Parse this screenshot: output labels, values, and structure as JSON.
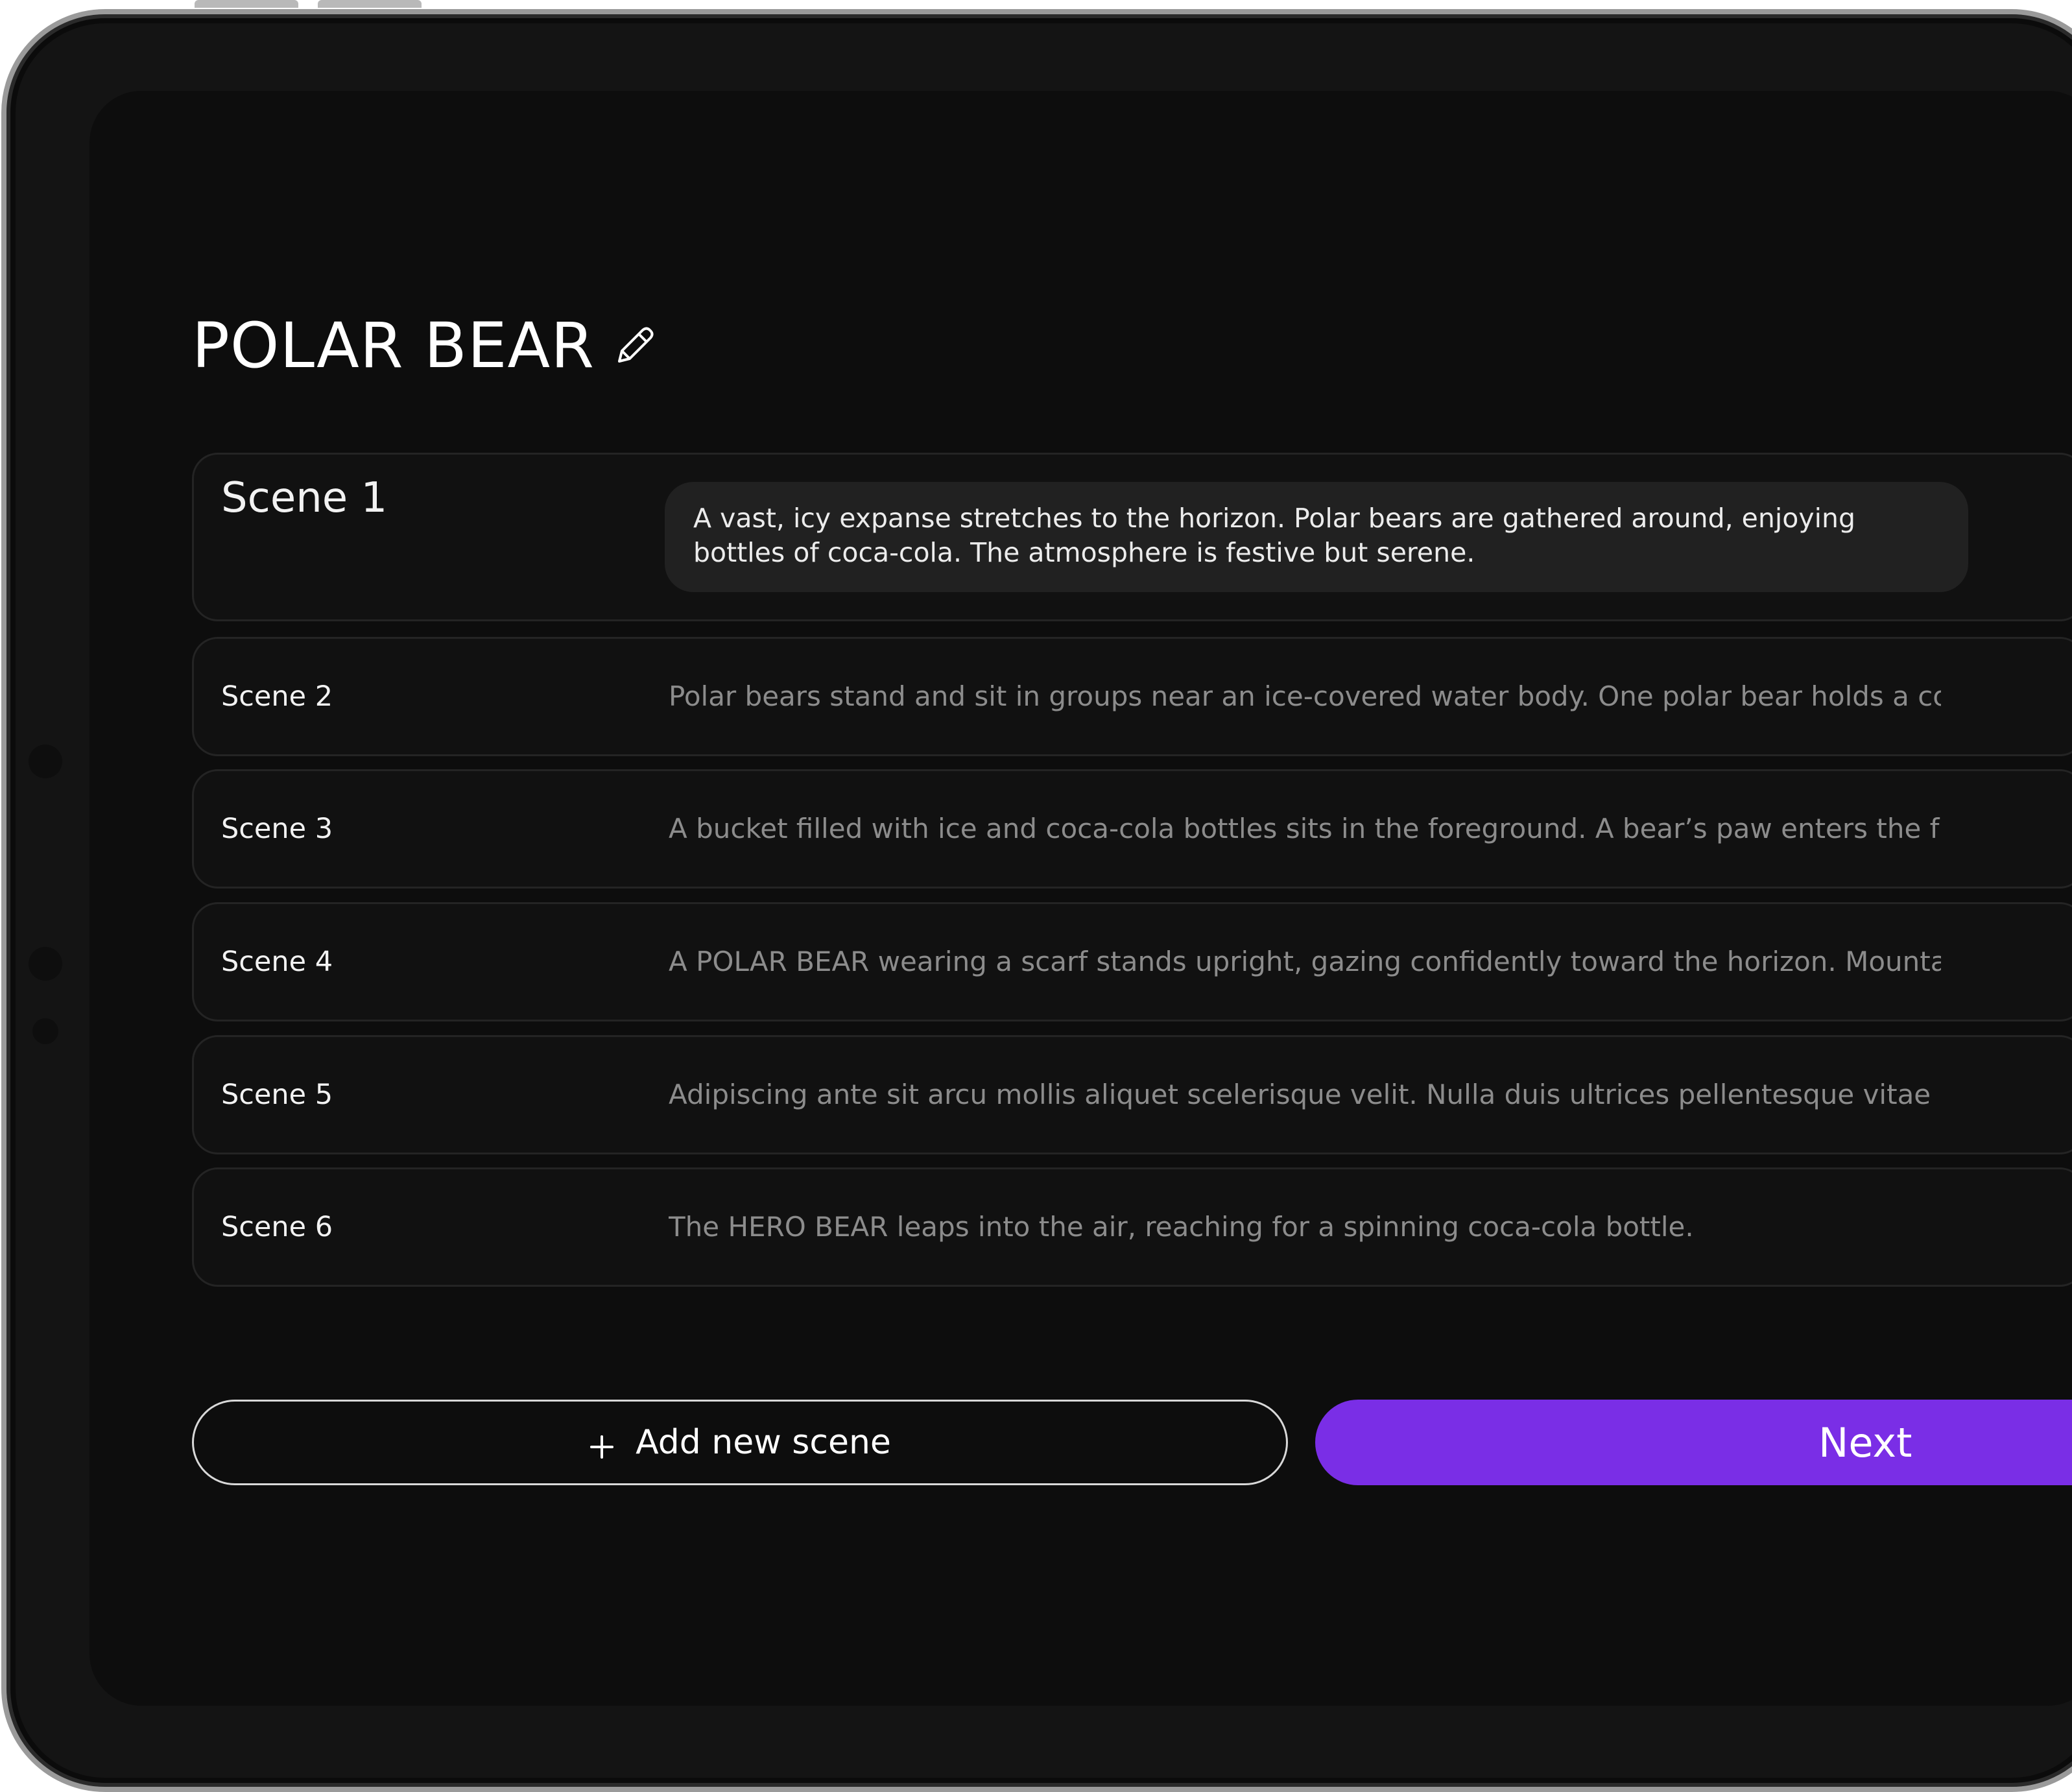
{
  "page": {
    "title": "POLAR BEAR",
    "edit_icon": "pencil-icon"
  },
  "scenes": [
    {
      "label": "Scene 1",
      "description": "A vast, icy expanse stretches to the horizon. Polar bears are gathered around, enjoying bottles of coca-cola. The atmosphere is festive but serene.",
      "expanded": true
    },
    {
      "label": "Scene 2",
      "description": "Polar bears stand and sit in groups near an ice-covered water body. One polar bear holds a coca-...",
      "expanded": false
    },
    {
      "label": "Scene 3",
      "description": "A bucket filled with ice and coca-cola bottles sits in the foreground. A bear’s paw enters the fram...",
      "expanded": false
    },
    {
      "label": "Scene 4",
      "description": "A POLAR BEAR wearing a scarf stands upright, gazing confidently toward the horizon. Mountains...",
      "expanded": false
    },
    {
      "label": "Scene 5",
      "description": "Adipiscing ante sit arcu mollis aliquet scelerisque velit. Nulla duis ultrices pellentesque vitae nunc...",
      "expanded": false
    },
    {
      "label": "Scene 6",
      "description": "The HERO BEAR leaps into the air, reaching for a spinning coca-cola bottle.",
      "expanded": false
    }
  ],
  "actions": {
    "add_label": "Add new scene",
    "add_icon": "plus-icon",
    "next_label": "Next"
  },
  "colors": {
    "background": "#0d0d0d",
    "accent": "#7a2ee6",
    "card_border": "#242424",
    "bubble": "#212121",
    "muted_text": "#8c8c8c"
  }
}
